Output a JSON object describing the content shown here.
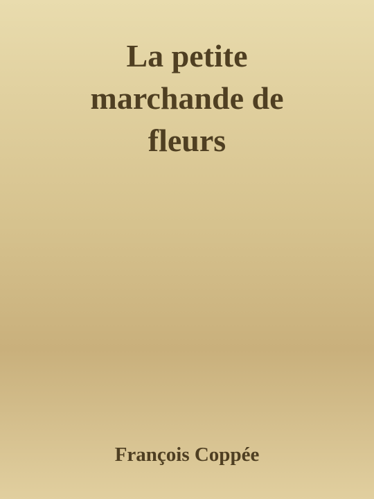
{
  "cover": {
    "title_lines": [
      "La petite",
      "marchande de",
      "fleurs"
    ],
    "author": "François Coppée"
  }
}
